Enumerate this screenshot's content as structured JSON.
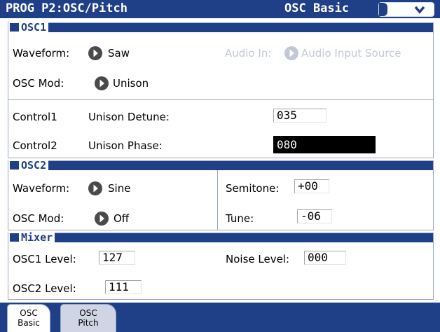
{
  "title": {
    "program": "PROG P2:OSC/Pitch",
    "page": "OSC Basic"
  },
  "osc1": {
    "header": "OSC1",
    "waveform_label": "Waveform:",
    "waveform_value": "Saw",
    "audio_in_label": "Audio In:",
    "audio_in_value": "Audio Input Source",
    "osc_mod_label": "OSC Mod:",
    "osc_mod_value": "Unison",
    "control1_label": "Control1",
    "control1_param": "Unison Detune:",
    "control1_value": "035",
    "control2_label": "Control2",
    "control2_param": "Unison Phase:",
    "control2_value": "080"
  },
  "osc2": {
    "header": "OSC2",
    "waveform_label": "Waveform:",
    "waveform_value": "Sine",
    "osc_mod_label": "OSC Mod:",
    "osc_mod_value": "Off",
    "semitone_label": "Semitone:",
    "semitone_value": "+00",
    "tune_label": "Tune:",
    "tune_value": "-06"
  },
  "mixer": {
    "header": "Mixer",
    "osc1_level_label": "OSC1 Level:",
    "osc1_level_value": "127",
    "noise_level_label": "Noise Level:",
    "noise_level_value": "000",
    "osc2_level_label": "OSC2 Level:",
    "osc2_level_value": "111"
  },
  "tabs": [
    {
      "line1": "OSC",
      "line2": "Basic",
      "active": true
    },
    {
      "line1": "OSC",
      "line2": "Pitch",
      "active": false
    }
  ],
  "colors": {
    "accent": "#1f3f86",
    "arrow": "#4a4a4a",
    "disabled": "#c2c8d6"
  }
}
